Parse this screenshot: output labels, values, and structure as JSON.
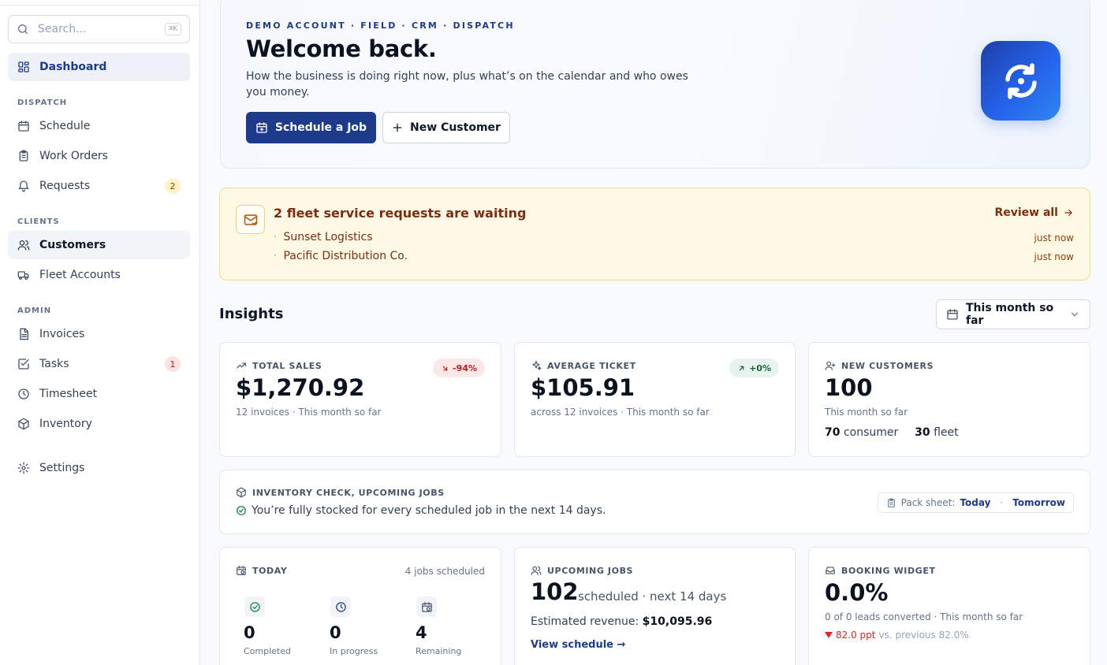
{
  "sidebar": {
    "search_placeholder": "Search...",
    "search_shortcut": "⌘K",
    "items": [
      {
        "label": "Dashboard"
      },
      {
        "label": "Schedule"
      },
      {
        "label": "Work Orders"
      },
      {
        "label": "Requests",
        "badge": "2"
      },
      {
        "label": "Customers"
      },
      {
        "label": "Fleet Accounts"
      },
      {
        "label": "Invoices"
      },
      {
        "label": "Tasks",
        "badge": "1"
      },
      {
        "label": "Timesheet"
      },
      {
        "label": "Inventory"
      },
      {
        "label": "Settings"
      }
    ],
    "sections": {
      "dispatch": "DISPATCH",
      "clients": "CLIENTS",
      "admin": "ADMIN"
    }
  },
  "hero": {
    "eyebrow": "DEMO ACCOUNT · FIELD · CRM · DISPATCH",
    "title": "Welcome back.",
    "subtitle": "How the business is doing right now, plus what’s on the calendar and who owes you money.",
    "primary_button": "Schedule a Job",
    "secondary_button": "New Customer"
  },
  "alert": {
    "title": "2 fleet service requests are waiting",
    "action": "Review all",
    "requests": [
      {
        "name": "Sunset Logistics",
        "time": "just now"
      },
      {
        "name": "Pacific Distribution Co.",
        "time": "just now"
      }
    ]
  },
  "insights": {
    "title": "Insights",
    "range": "This month so far",
    "total_sales": {
      "label": "TOTAL SALES",
      "value": "$1,270.92",
      "change": "-94%",
      "meta": "12 invoices · This month so far"
    },
    "average_ticket": {
      "label": "AVERAGE TICKET",
      "value": "$105.91",
      "change": "+0%",
      "meta": "across 12 invoices · This month so far"
    },
    "new_customers": {
      "label": "NEW CUSTOMERS",
      "value": "100",
      "meta": "This month so far",
      "consumer_count": "70",
      "consumer_label": "consumer",
      "fleet_count": "30",
      "fleet_label": "fleet"
    },
    "inventory": {
      "label": "INVENTORY CHECK, UPCOMING JOBS",
      "message": "You’re fully stocked for every scheduled job in the next 14 days.",
      "pack_label": "Pack sheet:",
      "pack_today": "Today",
      "pack_tomorrow": "Tomorrow"
    },
    "today": {
      "label": "TODAY",
      "meta": "4 jobs scheduled",
      "completed": "0",
      "completed_label": "Completed",
      "in_progress": "0",
      "in_progress_label": "In progress",
      "remaining": "4",
      "remaining_label": "Remaining"
    },
    "upcoming": {
      "label": "UPCOMING JOBS",
      "value": "102",
      "suffix": "scheduled · next 14 days",
      "revenue_label": "Estimated revenue:",
      "revenue_value": "$10,095.96",
      "link": "View schedule →"
    },
    "booking": {
      "label": "BOOKING WIDGET",
      "value": "0.0%",
      "meta": "0 of 0 leads converted · This month so far",
      "delta": "82.0 ppt",
      "delta_suffix": "vs. previous 82.0%"
    }
  },
  "colors": {
    "brand": "#1e3a8a",
    "alert_bg": "#fef9e4",
    "negative": "#dc2626",
    "positive": "#166534"
  }
}
